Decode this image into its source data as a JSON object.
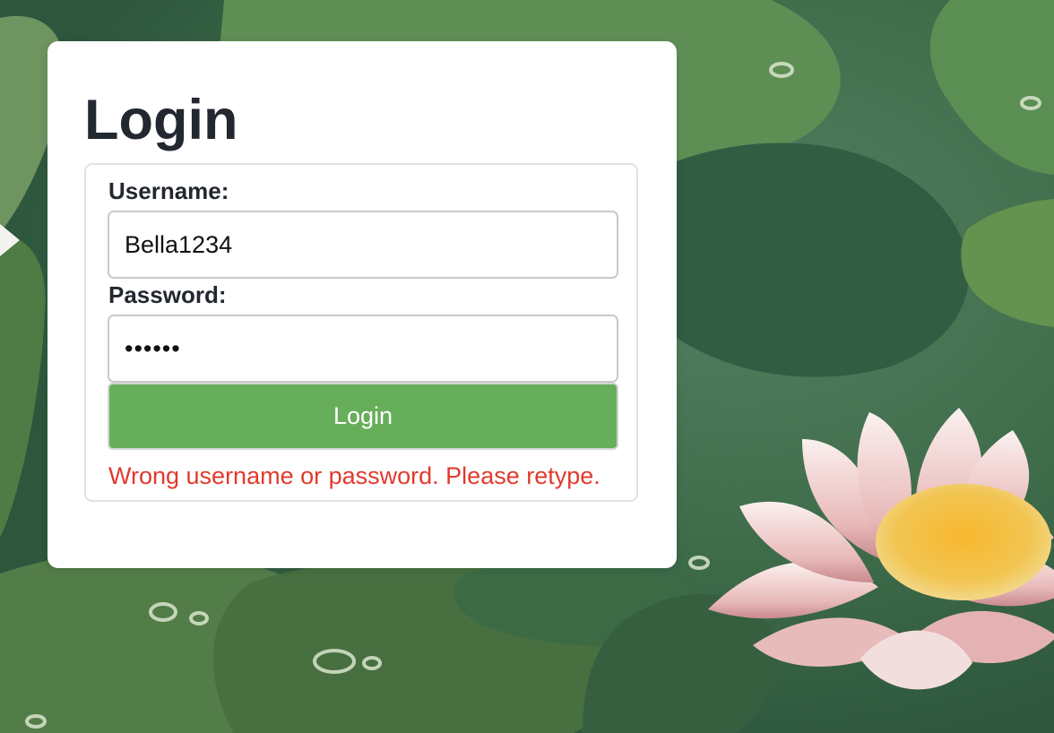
{
  "login": {
    "title": "Login",
    "username_label": "Username:",
    "username_value": "Bella1234",
    "password_label": "Password:",
    "password_value": "••••••",
    "button_label": "Login",
    "error_message": "Wrong username or password. Please retype."
  },
  "colors": {
    "button": "#67ae5b",
    "error": "#e03a2d",
    "title": "#23272f"
  },
  "background": {
    "subject": "water-lily-pond",
    "icon": "lotus-flower"
  }
}
